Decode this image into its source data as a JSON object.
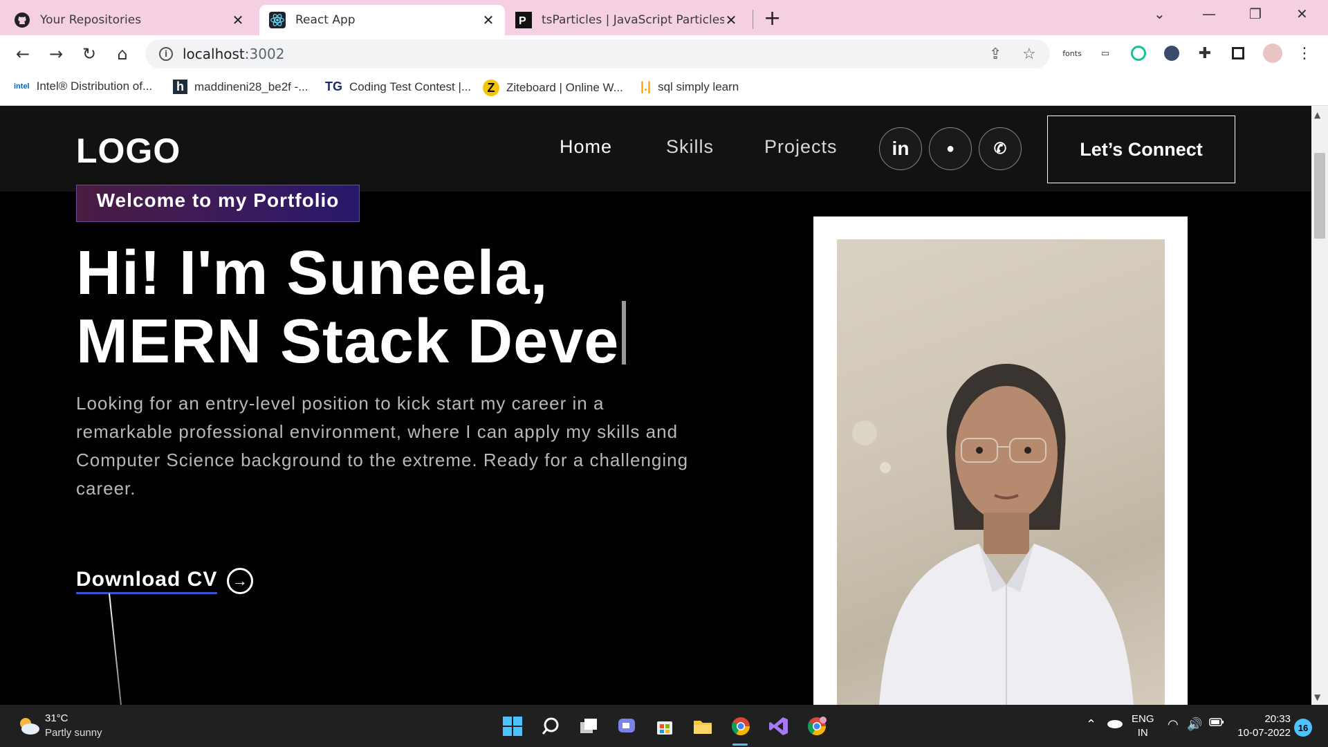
{
  "browser": {
    "tabs": [
      {
        "title": "Your Repositories",
        "icon": "github-icon"
      },
      {
        "title": "React App",
        "icon": "react-icon"
      },
      {
        "title": "tsParticles | JavaScript Particles, Con",
        "icon": "tsparticles-icon"
      }
    ],
    "url_host": "localhost",
    "url_port": ":3002",
    "ext_fonts_label": "fonts",
    "bookmarks": [
      {
        "icon_text": "intel",
        "label": "Intel® Distribution of..."
      },
      {
        "icon_text": "h",
        "label": "maddineni28_be2f -..."
      },
      {
        "icon_text": "TG",
        "label": "Coding Test Contest |..."
      },
      {
        "icon_text": "Z",
        "label": "Ziteboard | Online W..."
      },
      {
        "icon_text": "|.|",
        "label": "sql simply learn"
      }
    ]
  },
  "portfolio": {
    "logo": "LOGO",
    "nav": [
      "Home",
      "Skills",
      "Projects"
    ],
    "social": [
      "in",
      "●",
      "✆"
    ],
    "connect_label": "Let’s Connect",
    "tagline": "Welcome to my Portfolio",
    "headline_line1": "Hi! I'm Suneela,",
    "headline_line2": "MERN Stack Deve",
    "description": "Looking for an entry-level position to kick start my career in a remarkable professional environment, where I can apply my skills and Computer Science background to the extreme. Ready for a challenging career.",
    "download_label": "Download CV"
  },
  "taskbar": {
    "temperature": "31°C",
    "weather": "Partly sunny",
    "lang_top": "ENG",
    "lang_bottom": "IN",
    "time": "20:33",
    "date": "10-07-2022",
    "notification_count": "16"
  },
  "colors": {
    "tabstrip": "#f5d0e2",
    "accent_underline": "#2f55d4",
    "tagline_gradient_start": "#4b1c43",
    "tagline_gradient_end": "#27186b"
  }
}
